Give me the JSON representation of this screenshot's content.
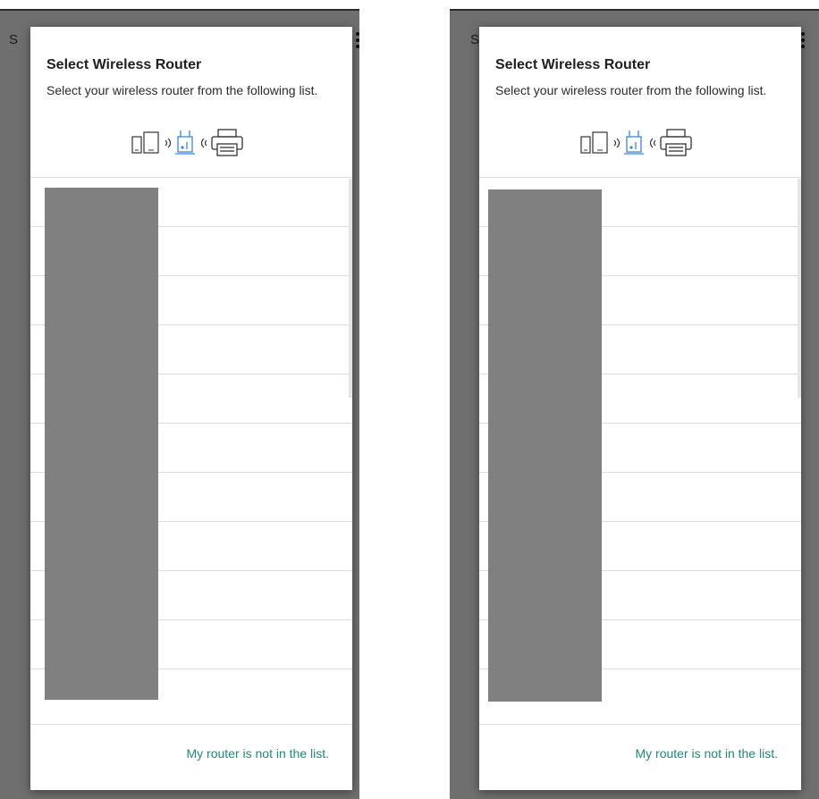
{
  "panels": [
    {
      "background": {
        "title_initial": "S"
      },
      "dialog": {
        "title": "Select Wireless Router",
        "description": "Select your wireless router from the following list.",
        "list": {
          "row_count": 11,
          "entries_redacted": true
        },
        "footer_link": "My router is not in the list."
      }
    },
    {
      "background": {
        "title_initial": "S"
      },
      "dialog": {
        "title": "Select Wireless Router",
        "description": "Select your wireless router from the following list.",
        "list": {
          "row_count": 11,
          "entries_redacted": true
        },
        "footer_link": "My router is not in the list."
      }
    }
  ],
  "colors": {
    "accent_link": "#1f8a7a",
    "router_icon": "#3a86d8",
    "scrim": "#6f6f6f",
    "redaction": "#808080"
  },
  "icons": [
    "smartphone-icon",
    "tablet-icon",
    "wifi-signal-icon",
    "router-icon",
    "printer-icon",
    "overflow-menu-icon"
  ]
}
